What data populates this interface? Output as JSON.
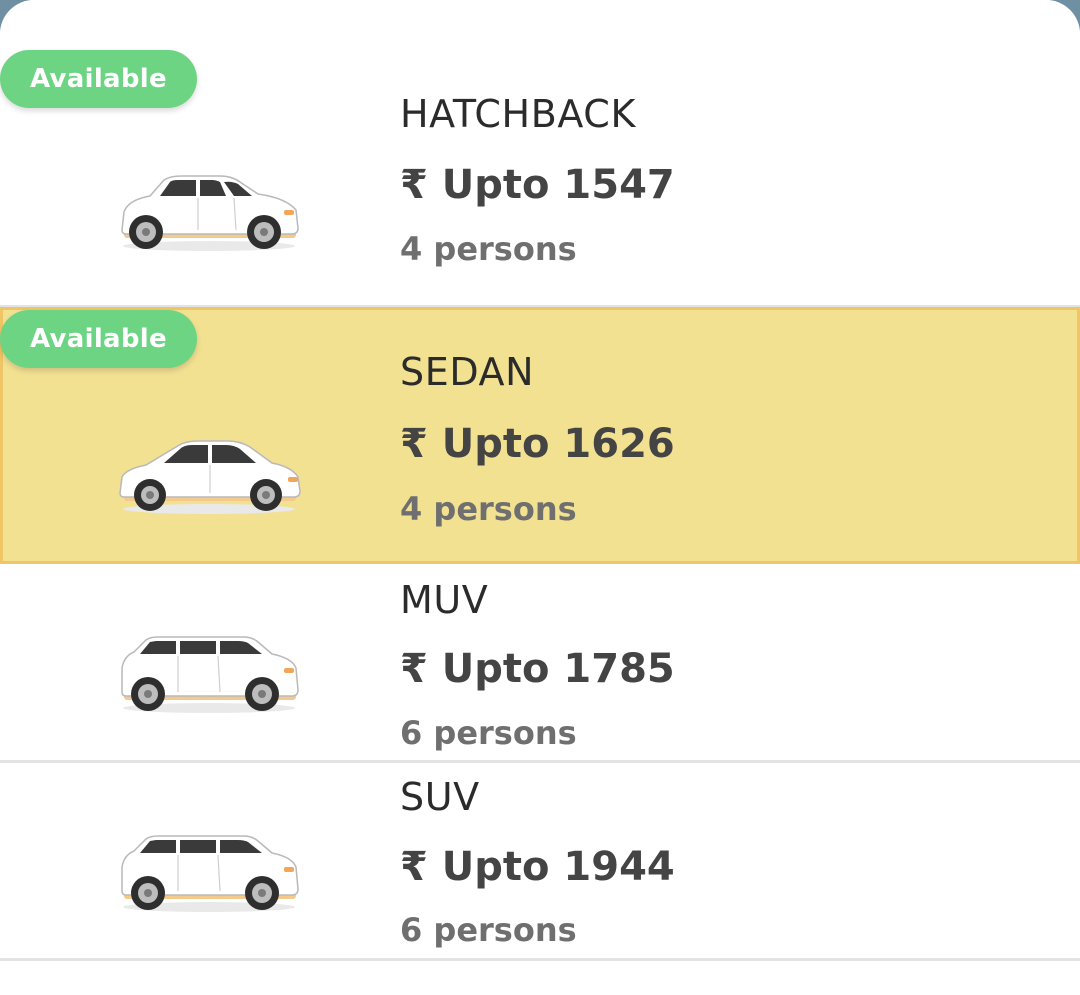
{
  "colors": {
    "available_badge": "#6dd484",
    "selected_row_bg": "#f3e192",
    "selected_row_border": "#f0c565",
    "divider": "#e3e3e3"
  },
  "cab_options": [
    {
      "badge": "Available",
      "name": "HATCHBACK",
      "price": "₹ Upto 1547",
      "capacity": "4 persons",
      "icon": "hatchback-car-icon",
      "selected": false
    },
    {
      "badge": "Available",
      "name": "SEDAN",
      "price": "₹ Upto 1626",
      "capacity": "4 persons",
      "icon": "sedan-car-icon",
      "selected": true
    },
    {
      "name": "MUV",
      "price": "₹ Upto 1785",
      "capacity": "6 persons",
      "icon": "muv-car-icon",
      "selected": false
    },
    {
      "name": "SUV",
      "price": "₹ Upto 1944",
      "capacity": "6 persons",
      "icon": "suv-car-icon",
      "selected": false
    }
  ]
}
